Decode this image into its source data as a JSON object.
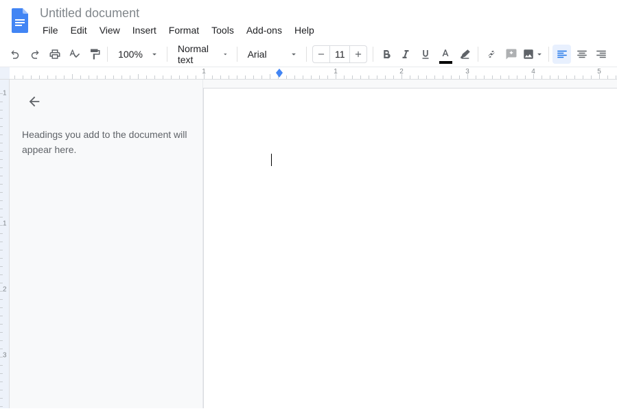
{
  "header": {
    "title": "Untitled document",
    "menus": [
      "File",
      "Edit",
      "View",
      "Insert",
      "Format",
      "Tools",
      "Add-ons",
      "Help"
    ]
  },
  "toolbar": {
    "zoom": "100%",
    "styleName": "Normal text",
    "fontName": "Arial",
    "fontSize": "11"
  },
  "outline": {
    "hint": "Headings you add to the document will appear here."
  },
  "ruler": {
    "h": [
      "1",
      "1",
      "2",
      "3",
      "4",
      "5"
    ],
    "v": [
      "1",
      "1",
      "2",
      "3"
    ]
  }
}
